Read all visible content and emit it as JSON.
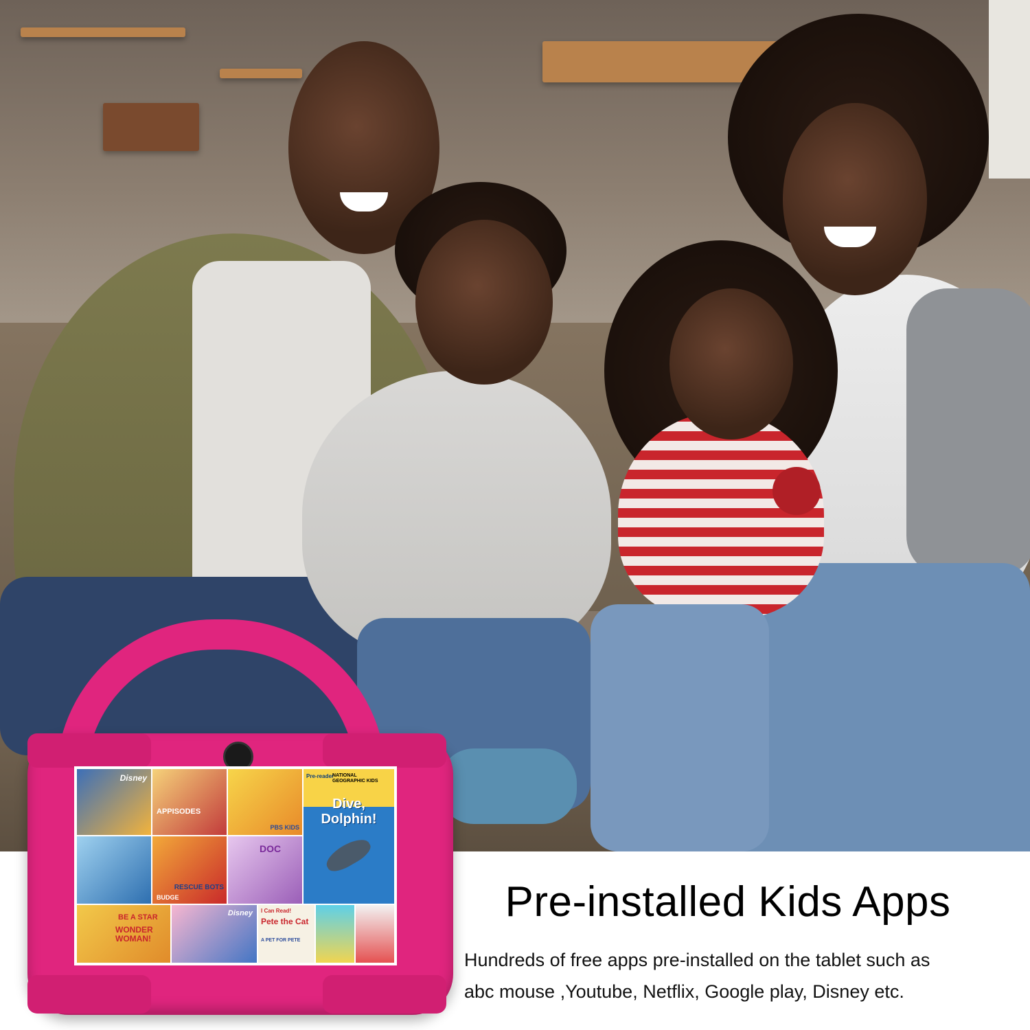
{
  "headline": "Pre-installed Kids Apps",
  "description_line1": "Hundreds of free apps pre-installed on the tablet such as",
  "description_line2": "abc mouse ,Youtube, Netflix, Google play, Disney etc.",
  "tablet": {
    "case_color": "#e0257e",
    "tiles": {
      "disney": "Disney",
      "dive_dolphin": "Dive, Dolphin!",
      "nat_geo": "NATIONAL GEOGRAPHIC KIDS",
      "pre_reader": "Pre-reader",
      "be_a_star": "BE A STAR",
      "wonder_woman": "WONDER WOMAN!",
      "pete_the_cat": "Pete the Cat",
      "i_can_read": "I Can Read!",
      "a_pet_for_pete": "A PET FOR PETE",
      "budge": "BUDGE",
      "rescue_bots": "RESCUE BOTS",
      "appisodes": "APPISODES",
      "pbs": "PBS KIDS",
      "doc": "DOC"
    }
  }
}
